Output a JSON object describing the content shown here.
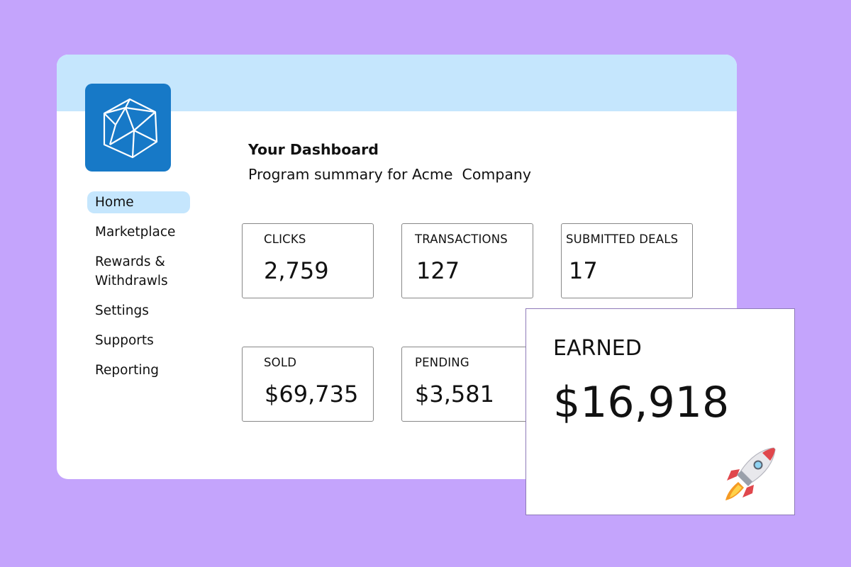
{
  "sidebar": {
    "items": [
      {
        "label": "Home",
        "active": true
      },
      {
        "label": "Marketplace",
        "active": false
      },
      {
        "label": "Rewards &\nWithdrawls",
        "active": false
      },
      {
        "label": "Settings",
        "active": false
      },
      {
        "label": "Supports",
        "active": false
      },
      {
        "label": "Reporting",
        "active": false
      }
    ]
  },
  "main": {
    "title": "Your Dashboard",
    "subtitle": "Program summary for Acme  Company"
  },
  "stats": {
    "clicks": {
      "label": "CLICKS",
      "value": "2,759"
    },
    "transactions": {
      "label": "TRANSACTIONS",
      "value": "127"
    },
    "submitted_deals": {
      "label": "SUBMITTED DEALS",
      "value": "17"
    },
    "sold": {
      "label": "SOLD",
      "value": "$69,735"
    },
    "pending": {
      "label": "PENDING",
      "value": "$3,581"
    }
  },
  "earned": {
    "label": "EARNED",
    "value": "$16,918",
    "icon": "rocket-icon"
  },
  "colors": {
    "background": "#c4a4fc",
    "header": "#c5e6fd",
    "logo": "#1779c7",
    "active_nav": "#c5e6fd"
  }
}
